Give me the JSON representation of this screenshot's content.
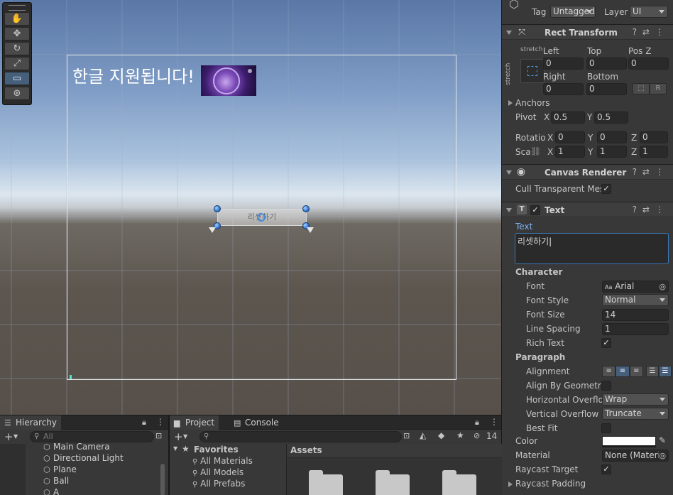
{
  "scene": {
    "korean_text": "한글 지원됩니다!",
    "button_label": "리셋하기"
  },
  "inspector": {
    "tag_label": "Tag",
    "tag_value": "Untagged",
    "layer_label": "Layer",
    "layer_value": "UI",
    "rect_transform": {
      "title": "Rect Transform",
      "stretch_top": "stretch",
      "stretch_side": "stretch",
      "left_label": "Left",
      "left_value": "0",
      "top_label": "Top",
      "top_value": "0",
      "posz_label": "Pos Z",
      "posz_value": "0",
      "right_label": "Right",
      "right_value": "0",
      "bottom_label": "Bottom",
      "bottom_value": "0",
      "r_label": "R",
      "anchors_label": "Anchors",
      "pivot_label": "Pivot",
      "pivot_x": "0.5",
      "pivot_y": "0.5",
      "rotation_label": "Rotatio",
      "rot_x": "0",
      "rot_y": "0",
      "rot_z": "0",
      "scale_label": "Sca",
      "scale_x": "1",
      "scale_y": "1",
      "scale_z": "1",
      "x_label": "X",
      "y_label": "Y",
      "z_label": "Z"
    },
    "canvas_renderer": {
      "title": "Canvas Renderer",
      "cull_label": "Cull Transparent Mes",
      "cull_checked": "✓"
    },
    "text_component": {
      "title": "Text",
      "text_label": "Text",
      "text_value": "리셋하기",
      "character_label": "Character",
      "font_label": "Font",
      "font_value": "Arial",
      "font_prefix": "Aa",
      "font_style_label": "Font Style",
      "font_style_value": "Normal",
      "font_size_label": "Font Size",
      "font_size_value": "14",
      "line_spacing_label": "Line Spacing",
      "line_spacing_value": "1",
      "rich_text_label": "Rich Text",
      "rich_text_checked": "✓",
      "paragraph_label": "Paragraph",
      "alignment_label": "Alignment",
      "align_geometry_label": "Align By Geometry",
      "horizontal_overflow_label": "Horizontal Overflo",
      "horizontal_overflow_value": "Wrap",
      "vertical_overflow_label": "Vertical Overflow",
      "vertical_overflow_value": "Truncate",
      "best_fit_label": "Best Fit",
      "color_label": "Color",
      "material_label": "Material",
      "material_value": "None (Materi",
      "raycast_target_label": "Raycast Target",
      "raycast_target_checked": "✓",
      "raycast_padding_label": "Raycast Padding"
    }
  },
  "hierarchy": {
    "tab_label": "Hierarchy",
    "search_placeholder": "All",
    "items": [
      "Main Camera",
      "Directional Light",
      "Plane",
      "Ball",
      "A"
    ]
  },
  "project": {
    "tab_label": "Project",
    "console_tab_label": "Console",
    "favorites_label": "Favorites",
    "favorites": [
      "All Materials",
      "All Models",
      "All Prefabs"
    ],
    "assets_label": "Assets",
    "hidden_count": "14"
  },
  "colors": {
    "accent": "#4a8ad8",
    "inspector_bg": "#383838",
    "field_bg": "#2a2a2a"
  }
}
